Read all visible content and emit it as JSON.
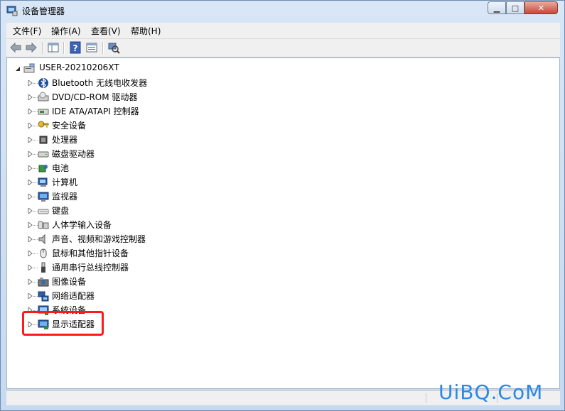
{
  "window": {
    "title": "设备管理器"
  },
  "menu": [
    {
      "label": "文件(F)"
    },
    {
      "label": "操作(A)"
    },
    {
      "label": "查看(V)"
    },
    {
      "label": "帮助(H)"
    }
  ],
  "tree": {
    "root": "USER-20210206XT",
    "items": [
      {
        "label": "Bluetooth 无线电收发器",
        "icon": "bluetooth-icon"
      },
      {
        "label": "DVD/CD-ROM 驱动器",
        "icon": "dvd-drive-icon"
      },
      {
        "label": "IDE ATA/ATAPI 控制器",
        "icon": "ide-controller-icon"
      },
      {
        "label": "安全设备",
        "icon": "security-key-icon"
      },
      {
        "label": "处理器",
        "icon": "processor-icon"
      },
      {
        "label": "磁盘驱动器",
        "icon": "disk-drive-icon"
      },
      {
        "label": "电池",
        "icon": "battery-icon"
      },
      {
        "label": "计算机",
        "icon": "computer-icon"
      },
      {
        "label": "监视器",
        "icon": "monitor-icon"
      },
      {
        "label": "键盘",
        "icon": "keyboard-icon"
      },
      {
        "label": "人体学输入设备",
        "icon": "hid-icon"
      },
      {
        "label": "声音、视频和游戏控制器",
        "icon": "sound-icon"
      },
      {
        "label": "鼠标和其他指针设备",
        "icon": "mouse-icon"
      },
      {
        "label": "通用串行总线控制器",
        "icon": "usb-icon"
      },
      {
        "label": "图像设备",
        "icon": "camera-icon"
      },
      {
        "label": "网络适配器",
        "icon": "network-adapter-icon"
      },
      {
        "label": "系统设备",
        "icon": "system-devices-icon"
      },
      {
        "label": "显示适配器",
        "icon": "display-adapter-icon"
      }
    ]
  },
  "watermark": "UiBQ.CoM",
  "colors": {
    "highlight": "#ff1a1a",
    "watermark": "#2b88e6",
    "menubar": "#f0f0f0"
  }
}
